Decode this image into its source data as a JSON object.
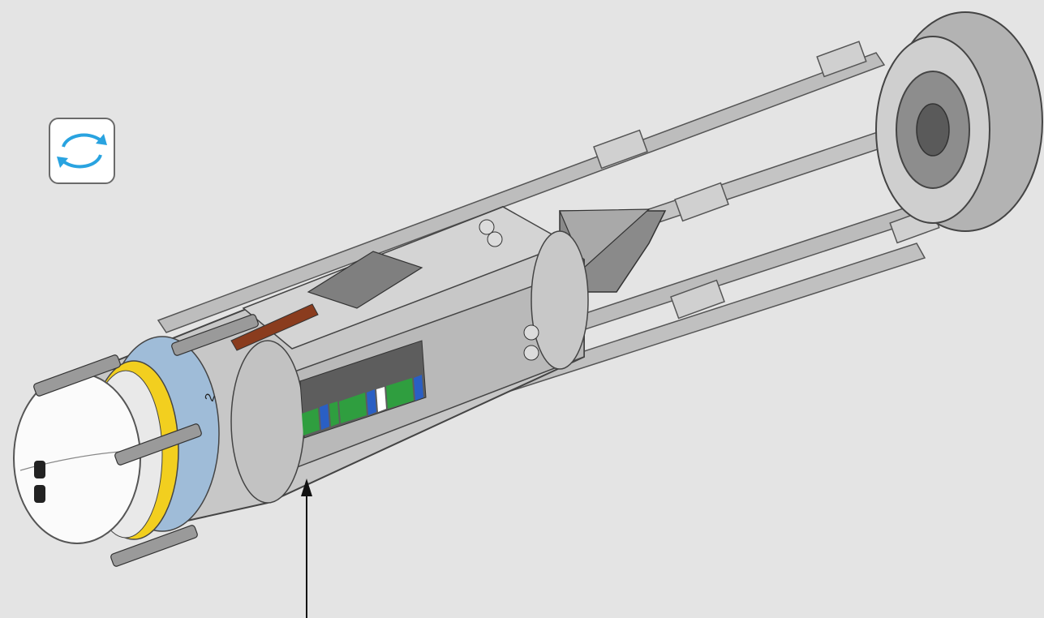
{
  "rotate_control": {
    "icon": "rotate-arrows-icon",
    "accent": "#29a3e0"
  },
  "model": {
    "subject": "assembled-brick-model",
    "markings": {
      "side_number": "2"
    },
    "colors": {
      "body": "#c7c7c7",
      "body_dark": "#9a9a9a",
      "cap": "#fbfbfb",
      "blue_ring": "#9fbcd8",
      "yellow": "#f2cf1f",
      "green": "#2f9e3f",
      "blue": "#2a5fc4",
      "brown": "#8a3c1e"
    }
  },
  "callout": {
    "icon": "callout-arrow-icon"
  }
}
